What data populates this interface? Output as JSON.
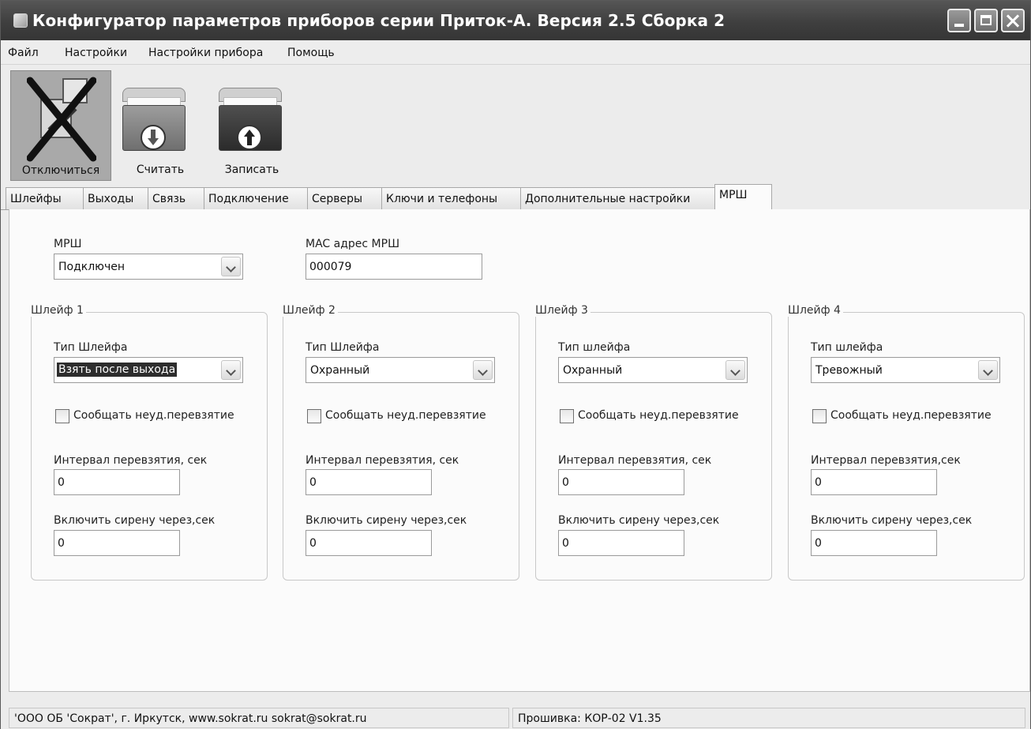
{
  "window": {
    "title": "Конфигуратор параметров приборов серии Приток-А. Версия 2.5 Сборка 2"
  },
  "menu": [
    "Файл",
    "Настройки",
    "Настройки прибора",
    "Помощь"
  ],
  "toolbar": {
    "disconnect": "Отключиться",
    "read": "Считать",
    "write": "Записать"
  },
  "tabs": [
    "Шлейфы",
    "Выходы",
    "Связь",
    "Подключение",
    "Серверы",
    "Ключи и телефоны",
    "Дополнительные настройки",
    "МРШ"
  ],
  "selected_tab": "МРШ",
  "mrsh": {
    "label": "МРШ",
    "value": "Подключен",
    "mac_label": "MAC адрес МРШ",
    "mac_value": "000079"
  },
  "loops": [
    {
      "title": "Шлейф 1",
      "type_label": "Тип Шлейфа",
      "type_value": "Взять после выхода",
      "report_label": "Сообщать неуд.перевзятие",
      "report_checked": false,
      "interval_label": "Интервал перевзятия, сек",
      "interval_value": "0",
      "siren_label": "Включить сирену через,сек",
      "siren_value": "0"
    },
    {
      "title": "Шлейф 2",
      "type_label": "Тип Шлейфа",
      "type_value": "Охранный",
      "report_label": "Сообщать неуд.перевзятие",
      "report_checked": false,
      "interval_label": "Интервал перевзятия, сек",
      "interval_value": "0",
      "siren_label": "Включить сирену через,сек",
      "siren_value": "0"
    },
    {
      "title": "Шлейф 3",
      "type_label": "Тип шлейфа",
      "type_value": "Охранный",
      "report_label": "Сообщать неуд.перевзятие",
      "report_checked": false,
      "interval_label": "Интервал перевзятия, сек",
      "interval_value": "0",
      "siren_label": "Включить сирену через,сек",
      "siren_value": "0"
    },
    {
      "title": "Шлейф 4",
      "type_label": "Тип шлейфа",
      "type_value": "Тревожный",
      "report_label": "Сообщать неуд.перевзятие",
      "report_checked": false,
      "interval_label": "Интервал перевзятия,сек",
      "interval_value": "0",
      "siren_label": "Включить сирену через,сек",
      "siren_value": "0"
    }
  ],
  "status": {
    "company": "'ООО ОБ 'Сократ', г. Иркутск,    www.sokrat.ru  sokrat@sokrat.ru",
    "firmware": "Прошивка: КОР-02 V1.35"
  }
}
